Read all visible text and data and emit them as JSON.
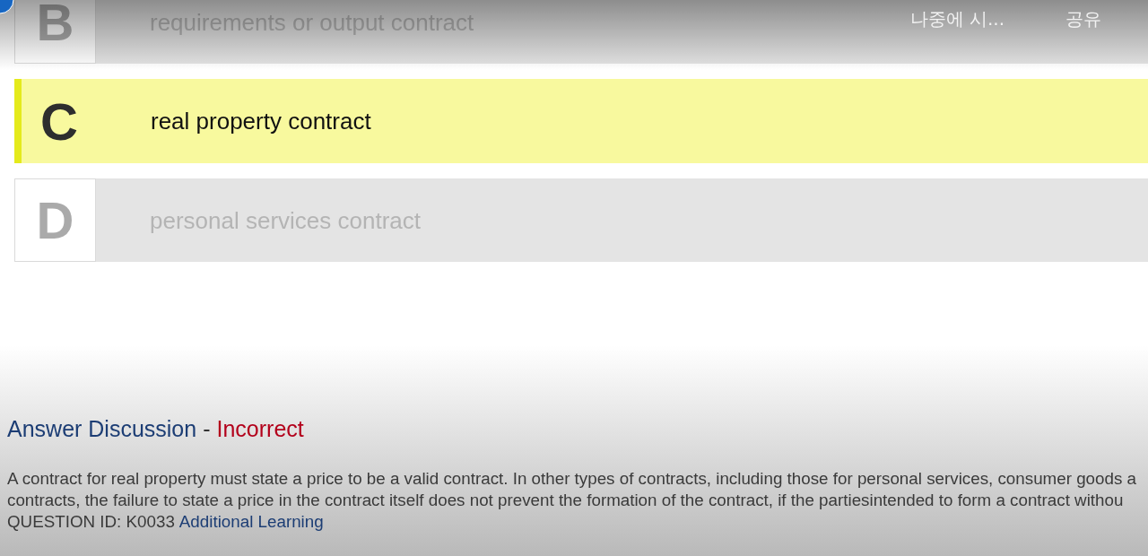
{
  "player": {
    "actions": [
      "나중에 시...",
      "공유"
    ]
  },
  "options": [
    {
      "letter": "B",
      "text": "requirements or output contract",
      "selected": false
    },
    {
      "letter": "C",
      "text": "real property contract",
      "selected": true
    },
    {
      "letter": "D",
      "text": "personal services contract",
      "selected": false
    }
  ],
  "discussion": {
    "title": "Answer Discussion",
    "separator": "-",
    "result": "Incorrect",
    "correct": false,
    "explanation_lines": [
      "A contract for real property must state a price to be a valid contract. In other types of contracts, including those for personal services, consumer goods a",
      "contracts, the failure to state a price in the contract itself does not prevent the formation of the contract, if the partiesintended to form a contract withou"
    ],
    "question_id": "QUESTION ID: K0033",
    "link": "Additional Learning"
  }
}
